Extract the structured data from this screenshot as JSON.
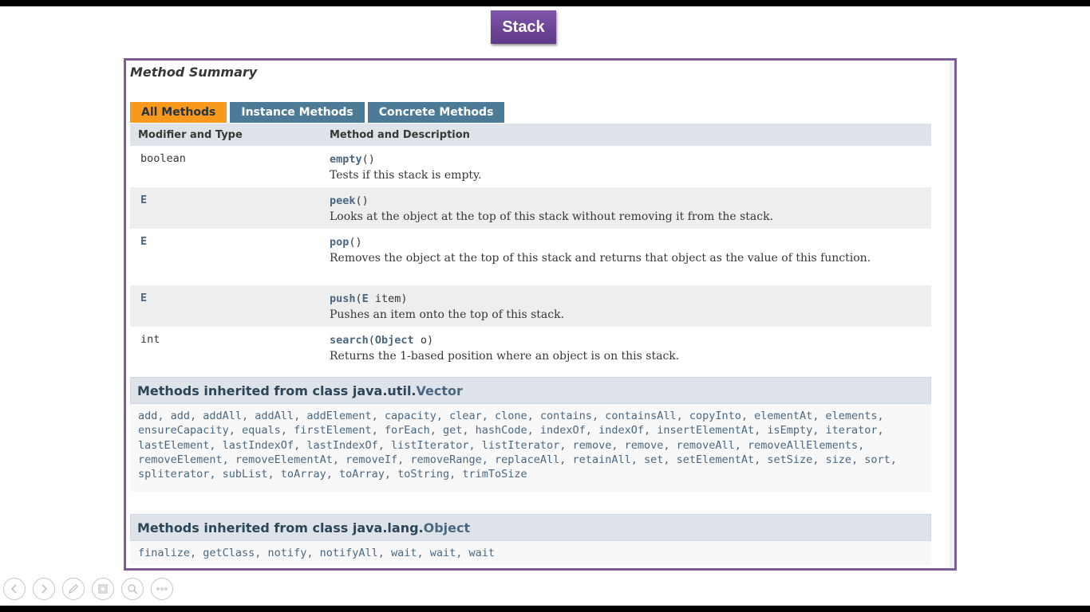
{
  "slide": {
    "title": "Stack"
  },
  "summary": {
    "title": "Method Summary",
    "tabs": [
      {
        "label": "All Methods",
        "active": true
      },
      {
        "label": "Instance Methods",
        "active": false
      },
      {
        "label": "Concrete Methods",
        "active": false
      }
    ],
    "columns": {
      "modifier": "Modifier and Type",
      "method": "Method and Description"
    },
    "rows": [
      {
        "type": "boolean",
        "method": "empty",
        "params": "()",
        "description": "Tests if this stack is empty."
      },
      {
        "type": "E",
        "method": "peek",
        "params": "()",
        "description": "Looks at the object at the top of this stack without removing it from the stack."
      },
      {
        "type": "E",
        "method": "pop",
        "params": "()",
        "description": "Removes the object at the top of this stack and returns that object as the value of this function."
      },
      {
        "type": "E",
        "method": "push",
        "param_type": "E",
        "param_name": " item)",
        "description": "Pushes an item onto the top of this stack."
      },
      {
        "type": "int",
        "method": "search",
        "param_type": "Object",
        "param_name": " o)",
        "description": "Returns the 1-based position where an object is on this stack."
      }
    ]
  },
  "inherited_vector": {
    "prefix": "Methods inherited from class java.util.",
    "class": "Vector",
    "methods": "add, add, addAll, addAll, addElement, capacity, clear, clone, contains, containsAll, copyInto, elementAt, elements, ensureCapacity, equals, firstElement, forEach, get, hashCode, indexOf, indexOf, insertElementAt, isEmpty, iterator, lastElement, lastIndexOf, lastIndexOf, listIterator, listIterator, remove, remove, removeAll, removeAllElements, removeElement, removeElementAt, removeIf, removeRange, replaceAll, retainAll, set, setElementAt, setSize, size, sort, spliterator, subList, toArray, toArray, toString, trimToSize"
  },
  "inherited_object": {
    "prefix": "Methods inherited from class java.lang.",
    "class": "Object",
    "methods": "finalize, getClass, notify, notifyAll, wait, wait, wait"
  },
  "nav": {
    "icons": [
      "previous-slide-icon",
      "next-slide-icon",
      "pen-icon",
      "slides-grid-icon",
      "zoom-icon",
      "more-options-icon"
    ]
  }
}
